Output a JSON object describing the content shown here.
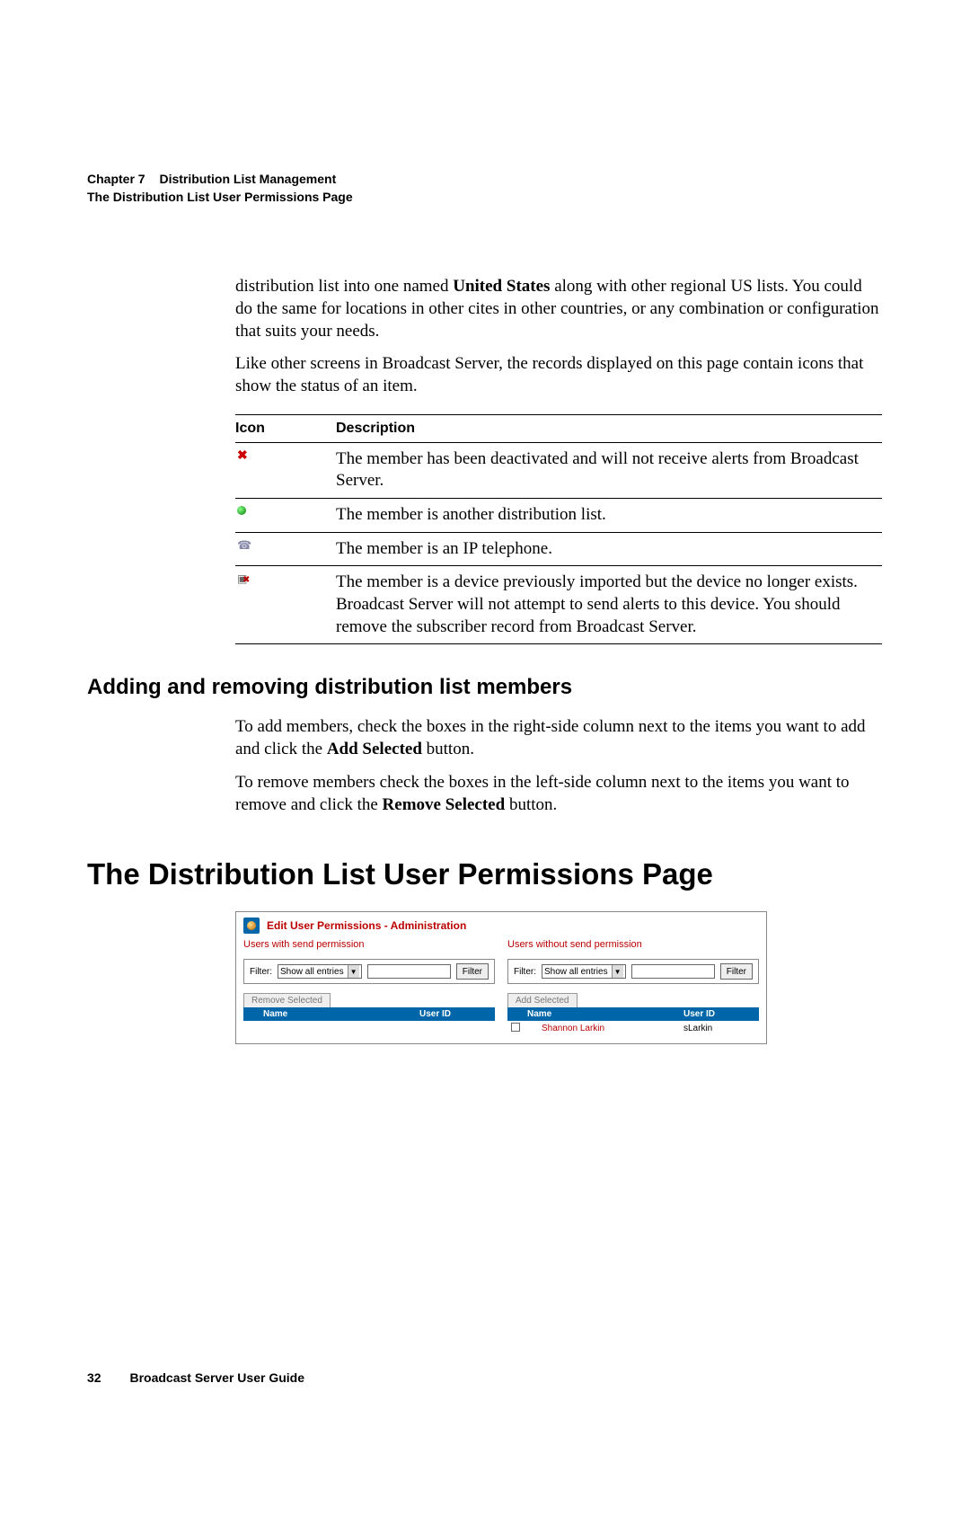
{
  "header": {
    "chapter_label": "Chapter 7",
    "chapter_title": "Distribution List Management",
    "page_title": "The Distribution List User Permissions Page"
  },
  "intro": {
    "p1a": "distribution list into one named ",
    "p1b": "United States",
    "p1c": " along with other regional US lists. You could do the same for locations in other cites in other countries, or any combination or configuration that suits your needs.",
    "p2": "Like other screens in Broadcast Server, the records displayed on this page contain icons that show the status of an item."
  },
  "icon_table": {
    "head_icon": "Icon",
    "head_desc": "Description",
    "rows": [
      {
        "icon": "x",
        "desc": "The member has been deactivated and will not receive alerts from Broadcast Server."
      },
      {
        "icon": "dot",
        "desc": "The member is another distribution list."
      },
      {
        "icon": "phone",
        "desc": "The member is an IP telephone."
      },
      {
        "icon": "dev",
        "desc": "The member is a device previously imported but the device no longer exists. Broadcast Server will not attempt to send alerts to this device. You should remove the subscriber record from Broadcast Server."
      }
    ]
  },
  "section_add_remove": {
    "heading": "Adding and removing distribution list members",
    "p1a": "To add members, check the boxes in the right-side column next to the items you want to add and click the ",
    "p1b": "Add Selected",
    "p1c": " button.",
    "p2a": "To remove members check the boxes in the left-side column next to the items you want to remove and click the ",
    "p2b": "Remove Selected",
    "p2c": " button."
  },
  "section_permissions": {
    "heading": "The Distribution List User Permissions Page"
  },
  "screenshot": {
    "title": "Edit User Permissions - Administration",
    "left": {
      "title": "Users with send permission",
      "filter_label": "Filter:",
      "select_value": "Show all entries",
      "filter_btn": "Filter",
      "action_btn": "Remove Selected",
      "col_name": "Name",
      "col_id": "User ID"
    },
    "right": {
      "title": "Users without send permission",
      "filter_label": "Filter:",
      "select_value": "Show all entries",
      "filter_btn": "Filter",
      "action_btn": "Add Selected",
      "col_name": "Name",
      "col_id": "User ID",
      "rows": [
        {
          "name": "Shannon Larkin",
          "id": "sLarkin"
        }
      ]
    }
  },
  "footer": {
    "page": "32",
    "doc": "Broadcast Server User Guide"
  }
}
